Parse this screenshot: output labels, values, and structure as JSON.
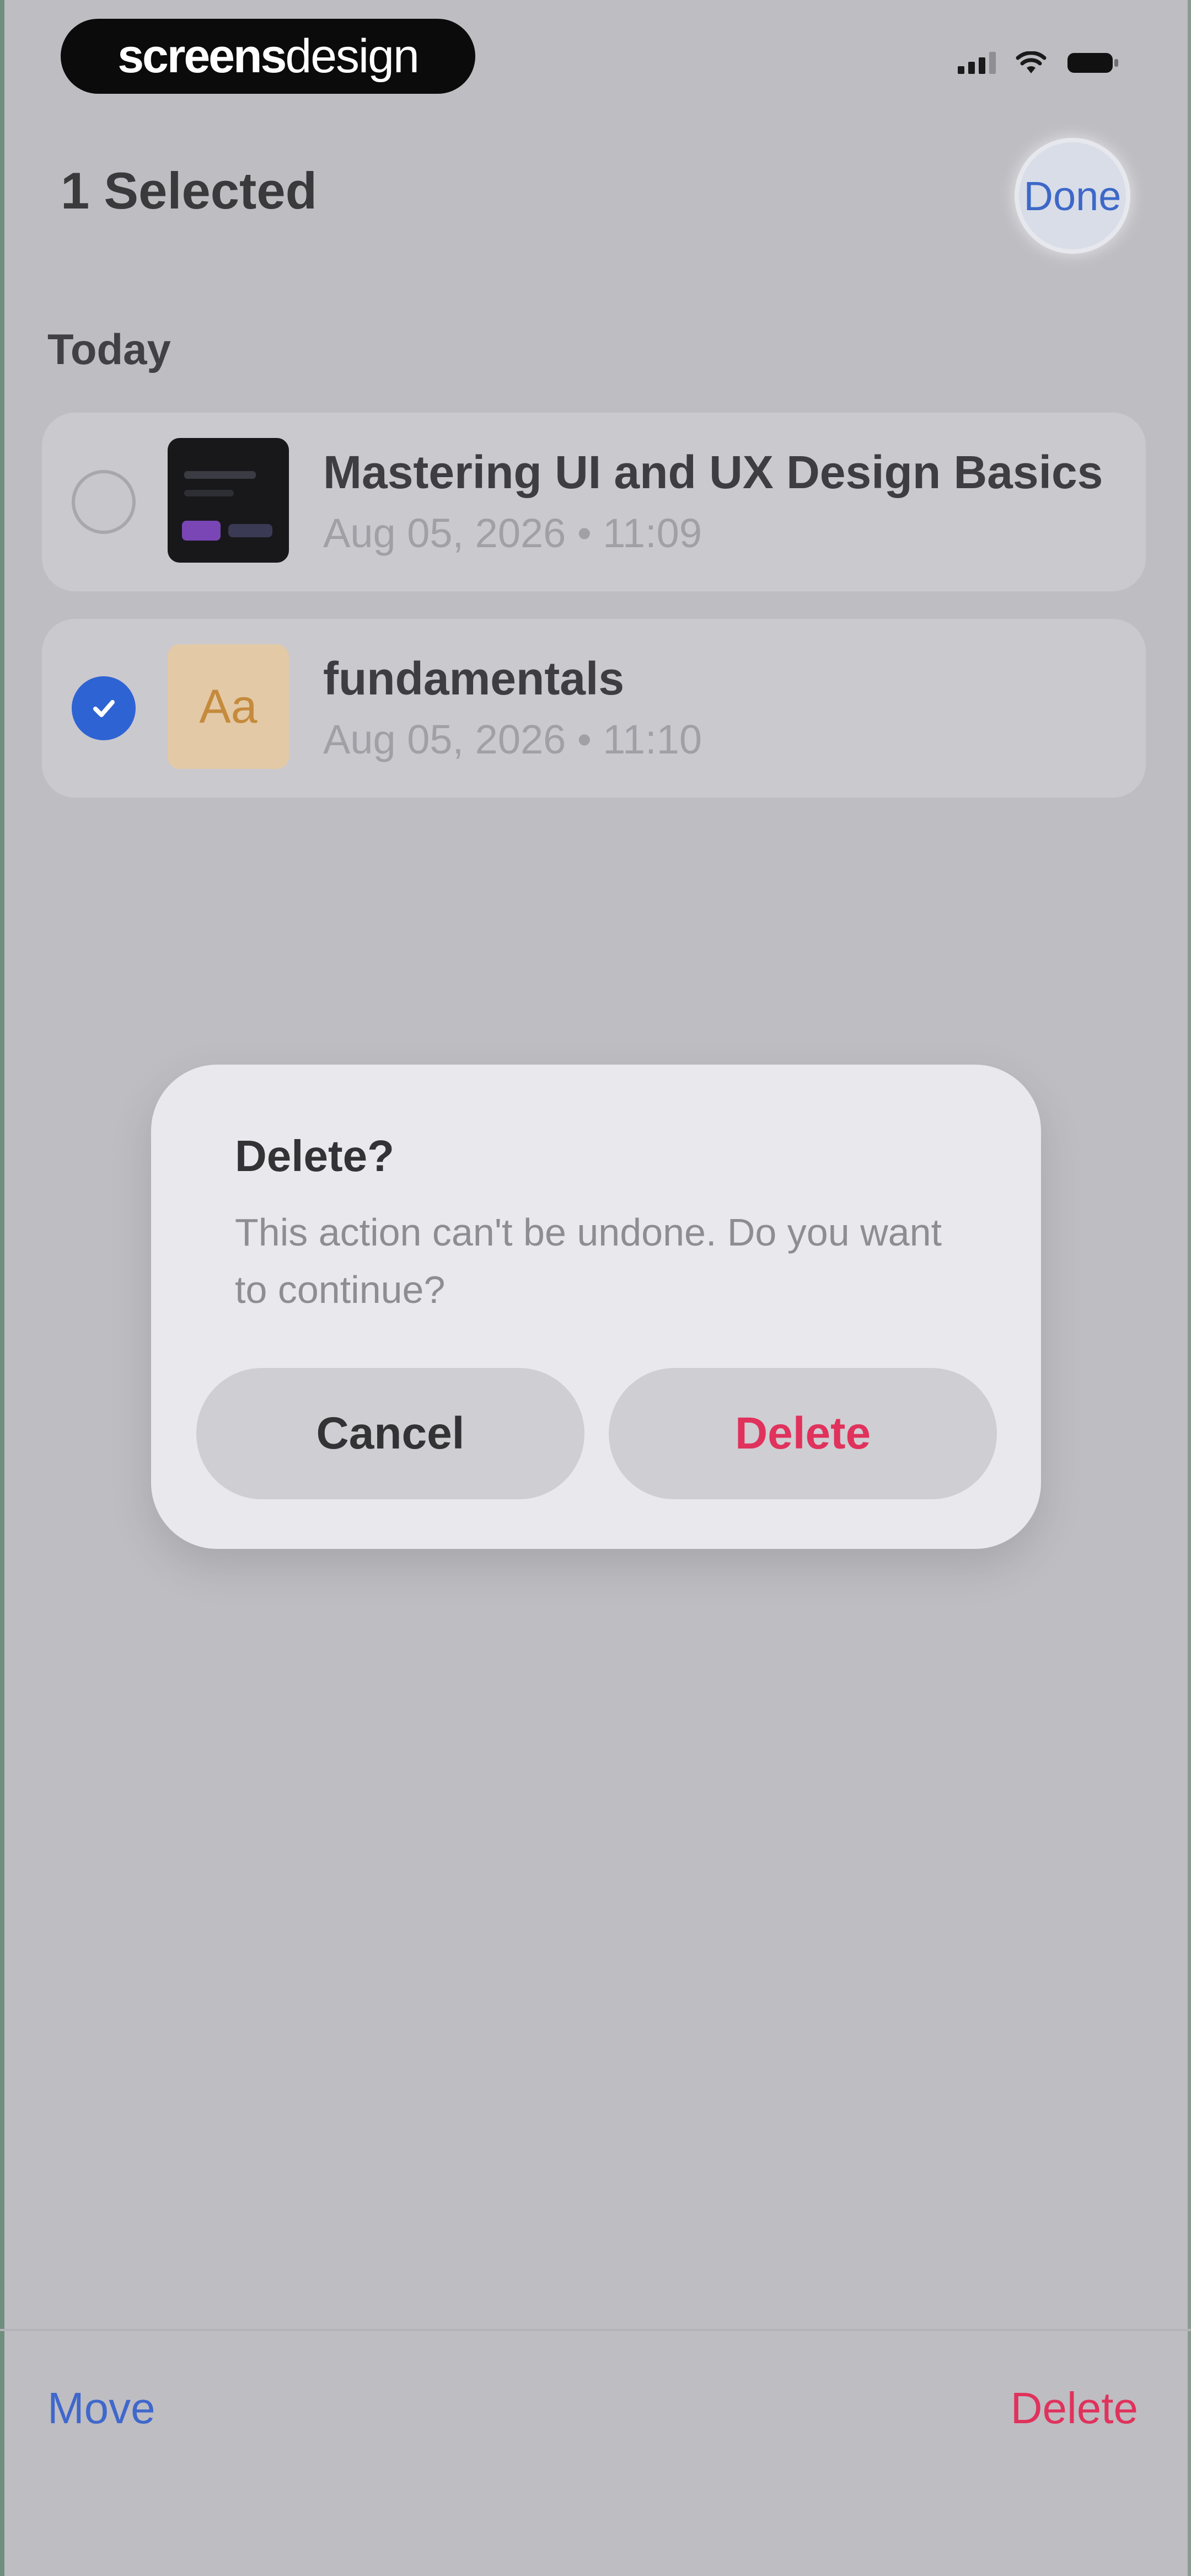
{
  "status_bar": {
    "brand_bold": "screens",
    "brand_light": "design",
    "signal_icon": "cellular-signal-icon",
    "wifi_icon": "wifi-icon",
    "battery_icon": "battery-icon"
  },
  "header": {
    "title": "1 Selected",
    "done_label": "Done"
  },
  "section": {
    "label": "Today"
  },
  "items": [
    {
      "title": "Mastering UI and UX Design Basics",
      "subtitle": "Aug 05, 2026 • 11:09",
      "selected": false,
      "thumbnail": "dark-ui-thumbnail"
    },
    {
      "title": "fundamentals",
      "subtitle": "Aug 05, 2026 • 11:10",
      "selected": true,
      "thumbnail_text": "Aa"
    }
  ],
  "dialog": {
    "title": "Delete?",
    "message": "This action can't be undone. Do you want to continue?",
    "cancel_label": "Cancel",
    "delete_label": "Delete"
  },
  "toolbar": {
    "move_label": "Move",
    "delete_label": "Delete"
  },
  "colors": {
    "accent_blue": "#3f68cc",
    "destructive_red": "#e0325c",
    "checkbox_blue": "#2e63d4"
  }
}
